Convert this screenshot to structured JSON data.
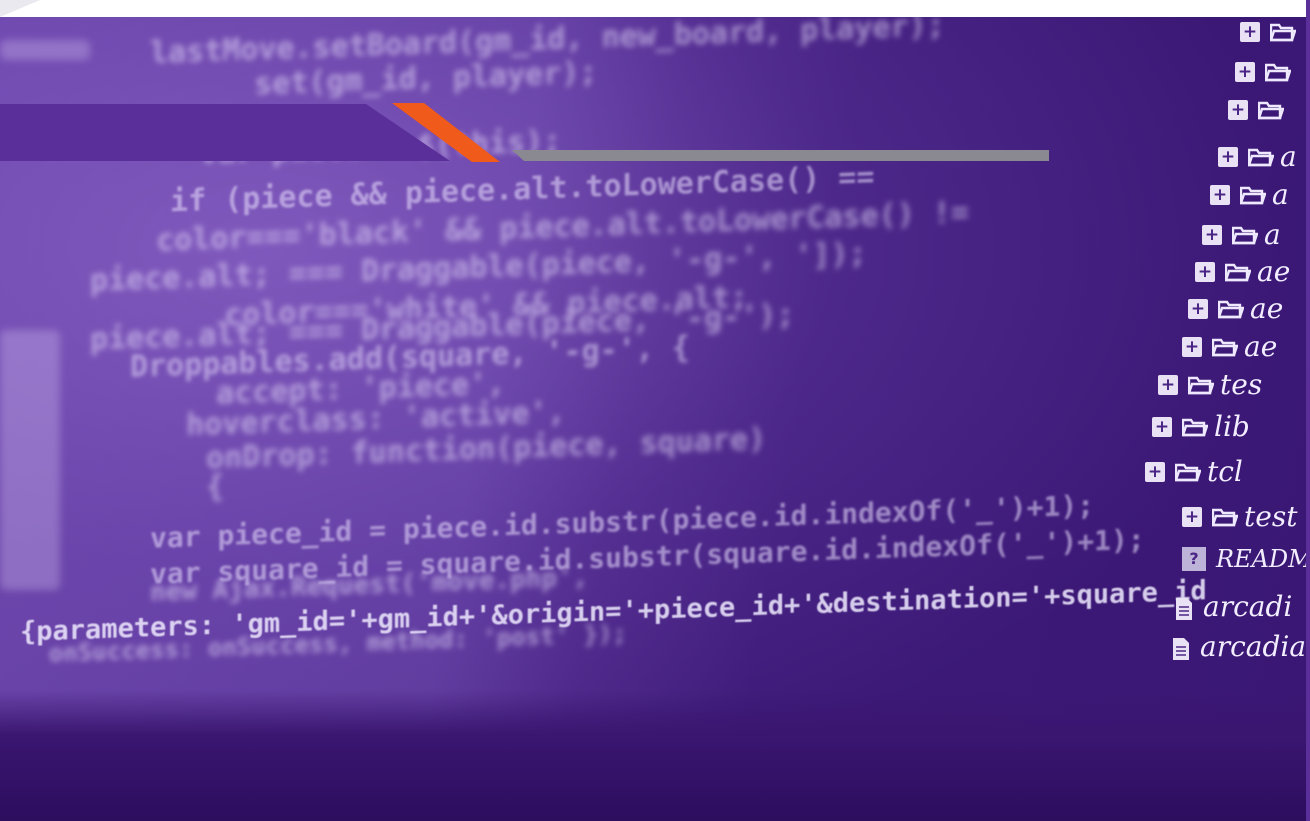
{
  "slide": {
    "title": ""
  },
  "code_lines": [
    "lastMove.setBoard(gm_id, new_board, player);",
    "   set(gm_id, player);",
    "var piece = $(this);",
    "if (piece && piece.alt.toLowerCase() ==",
    "  color==='black' && piece.alt.toLowerCase() !=",
    "piece.alt; === Draggable(piece, '-g-', ']);",
    "   color==='white' && piece.alt;",
    "piece.alt; === Draggable(piece, '-g-');",
    "Droppables.add(square, '-g-', {",
    "  accept: 'piece',",
    "  hoverclass: 'active',",
    "  onDrop: function(piece, square)",
    "  {",
    "var piece_id = piece.id.substr(piece.id.indexOf('_')+1);",
    "var square_id = square.id.substr(square.id.indexOf('_')+1);",
    "new Ajax.Request('move.php',",
    "{parameters: 'gm_id='+gm_id+'&origin='+piece_id+'&destination='+square_id",
    "  onSuccess: onSuccess, method: 'post' });"
  ],
  "file_tree": [
    {
      "kind": "folder",
      "label": ""
    },
    {
      "kind": "folder",
      "label": ""
    },
    {
      "kind": "folder",
      "label": ""
    },
    {
      "kind": "folder",
      "label": "a"
    },
    {
      "kind": "folder",
      "label": "a"
    },
    {
      "kind": "folder",
      "label": "a"
    },
    {
      "kind": "folder",
      "label": "ae"
    },
    {
      "kind": "folder",
      "label": "ae"
    },
    {
      "kind": "folder",
      "label": "ae"
    },
    {
      "kind": "folder",
      "label": "tes"
    },
    {
      "kind": "folder",
      "label": "lib"
    },
    {
      "kind": "folder",
      "label": "tcl"
    },
    {
      "kind": "folder",
      "label": "test"
    },
    {
      "kind": "readme",
      "label": "README"
    },
    {
      "kind": "file",
      "label": "arcadi"
    },
    {
      "kind": "file",
      "label": "arcadia"
    }
  ],
  "colors": {
    "accent_purple": "#5a2f99",
    "accent_orange": "#f05a1a",
    "accent_gray": "#8a8890",
    "background": "#3d1a78"
  },
  "icons": {
    "expand": "plus-box-icon",
    "folder": "folder-open-icon",
    "file": "document-icon",
    "readme": "unknown-file-icon"
  }
}
